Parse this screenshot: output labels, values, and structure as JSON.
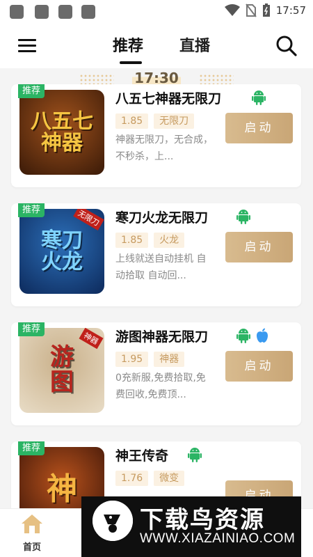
{
  "status_bar": {
    "time": "17:57"
  },
  "header": {
    "tabs": [
      {
        "label": "推荐"
      },
      {
        "label": "直播"
      }
    ]
  },
  "time_divider": {
    "time": "17:30"
  },
  "badge_label": "推荐",
  "launch_label": "启动",
  "games": [
    {
      "title": "八五七神器无限刀",
      "version": "1.85",
      "tag": "无限刀",
      "desc": "神器无限刀，无合成，不秒杀，上...",
      "cover_text": "八五七\n神器",
      "cover_colors": [
        "#3a1a08",
        "#a0521c"
      ],
      "cover_text_color": "#f5c542",
      "platforms": [
        "android"
      ]
    },
    {
      "title": "寒刀火龙无限刀",
      "version": "1.85",
      "tag": "火龙",
      "desc": "上线就送自动挂机 自动拾取 自动回...",
      "cover_text": "寒刀\n火龙",
      "cover_colors": [
        "#0d2a5c",
        "#2c6fb8"
      ],
      "cover_text_color": "#7fd3ff",
      "cover_corner": "无限刀",
      "platforms": [
        "android"
      ]
    },
    {
      "title": "游图神器无限刀",
      "version": "1.95",
      "tag": "神器",
      "desc": "0充新服,免费拾取,免费回收,免费顶...",
      "cover_text": "游\n图",
      "cover_colors": [
        "#e8dcc6",
        "#c9b08a"
      ],
      "cover_text_color": "#b8251e",
      "cover_corner": "神器",
      "platforms": [
        "android",
        "apple"
      ]
    },
    {
      "title": "神王传奇",
      "version": "1.76",
      "tag": "微变",
      "desc": "",
      "cover_text": "神",
      "cover_colors": [
        "#3a1408",
        "#b8521c"
      ],
      "cover_text_color": "#f5b542",
      "platforms": [
        "android"
      ]
    }
  ],
  "bottom_nav": {
    "home_label": "首页"
  },
  "watermark": {
    "title": "下载鸟资源",
    "url": "WWW.XIAZAINIAO.COM"
  },
  "colors": {
    "accent_gold": "#c9a676",
    "badge_green": "#2bb464",
    "android_green": "#2bb464",
    "apple_blue": "#3a9af0"
  }
}
